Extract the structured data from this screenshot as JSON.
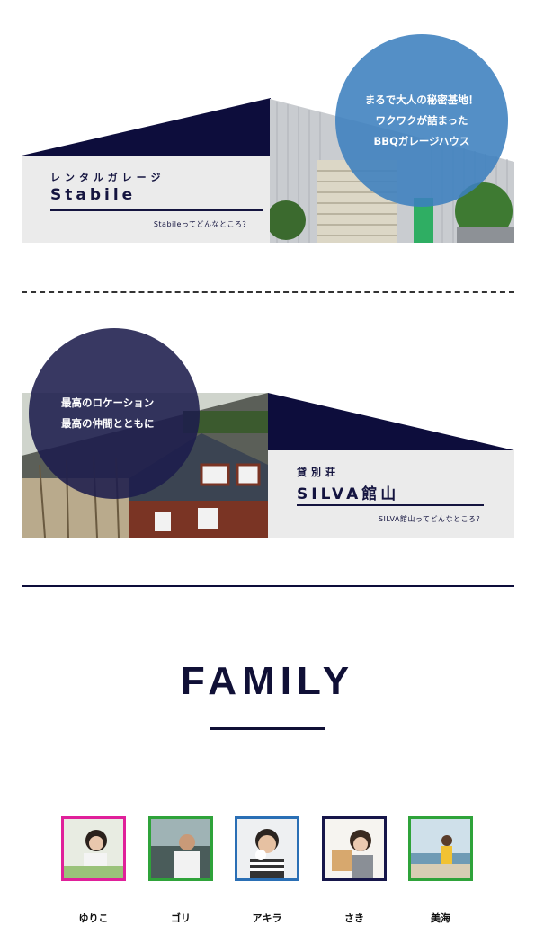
{
  "stabile": {
    "circle_lines": [
      "まるで大人の秘密基地！",
      "ワクワクが詰まった",
      "BBQガレージハウス"
    ],
    "subtitle": "レンタルガレージ",
    "name": "Stabile",
    "link": "Stabileってどんなところ？",
    "colors": {
      "roof": "#0d0d3c",
      "circle": "#3c80be"
    }
  },
  "silva": {
    "circle_lines": [
      "最高のロケーション",
      "最高の仲間とともに"
    ],
    "subtitle": "貸別荘",
    "name": "SILVA館山",
    "link": "SILVA館山ってどんなところ？",
    "colors": {
      "roof": "#0d0d3c",
      "circle": "#1c1c4c"
    }
  },
  "family": {
    "title": "FAMILY",
    "members": [
      {
        "name": "ゆりこ",
        "border": "#e0209a",
        "icon": "person-photo"
      },
      {
        "name": "ゴリ",
        "border": "#2fa33a",
        "icon": "person-photo"
      },
      {
        "name": "アキラ",
        "border": "#2a6fb5",
        "icon": "person-photo"
      },
      {
        "name": "さき",
        "border": "#16164a",
        "icon": "person-photo"
      },
      {
        "name": "美海",
        "border": "#2fa33a",
        "icon": "person-photo"
      }
    ]
  }
}
